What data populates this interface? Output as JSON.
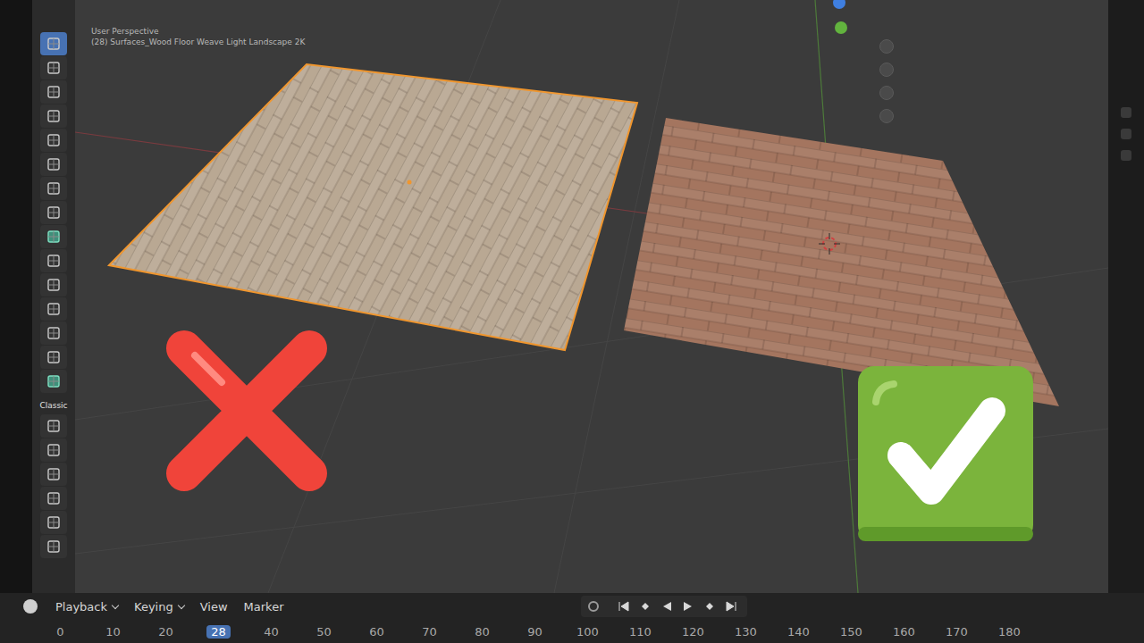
{
  "viewport": {
    "header": [
      "User Perspective",
      "(28) Surfaces_Wood Floor Weave Light Landscape 2K"
    ]
  },
  "toolbar": {
    "groups": [
      {
        "label": "",
        "tools": [
          {
            "kind": "tool",
            "selected": true
          },
          {
            "kind": "tool",
            "selected": false
          },
          {
            "kind": "tool",
            "selected": false
          },
          {
            "kind": "tool",
            "selected": false
          },
          {
            "kind": "tool",
            "selected": false
          },
          {
            "kind": "tool",
            "selected": false
          },
          {
            "kind": "tool",
            "selected": false
          },
          {
            "kind": "tool",
            "selected": false
          },
          {
            "kind": "add",
            "selected": false
          },
          {
            "kind": "tool",
            "selected": false
          },
          {
            "kind": "tool",
            "selected": false
          },
          {
            "kind": "tool",
            "selected": false
          },
          {
            "kind": "tool",
            "selected": false
          },
          {
            "kind": "tool",
            "selected": false
          },
          {
            "kind": "add",
            "selected": false
          }
        ]
      },
      {
        "label": "Classic",
        "tools": [
          {
            "kind": "tool",
            "selected": false
          },
          {
            "kind": "tool",
            "selected": false
          },
          {
            "kind": "tool",
            "selected": false
          },
          {
            "kind": "tool",
            "selected": false
          },
          {
            "kind": "tool",
            "selected": false
          },
          {
            "kind": "tool",
            "selected": false
          }
        ]
      }
    ]
  },
  "objects": [
    {
      "selected": true,
      "approved": false,
      "color": "#b9a893"
    },
    {
      "selected": false,
      "approved": true,
      "color": "#a4755f"
    }
  ],
  "timeline": {
    "menus": [
      {
        "label": "Playback",
        "kind": "dropdown"
      },
      {
        "label": "Keying",
        "kind": "dropdown"
      },
      {
        "label": "View",
        "kind": "menu"
      },
      {
        "label": "Marker",
        "kind": "menu"
      }
    ],
    "auto_key": false,
    "ticks": [
      {
        "label": "0",
        "current": false
      },
      {
        "label": "10",
        "current": false
      },
      {
        "label": "20",
        "current": false
      },
      {
        "label": "28",
        "current": true
      },
      {
        "label": "40",
        "current": false
      },
      {
        "label": "50",
        "current": false
      },
      {
        "label": "60",
        "current": false
      },
      {
        "label": "70",
        "current": false
      },
      {
        "label": "80",
        "current": false
      },
      {
        "label": "90",
        "current": false
      },
      {
        "label": "100",
        "current": false
      },
      {
        "label": "110",
        "current": false
      },
      {
        "label": "120",
        "current": false
      },
      {
        "label": "130",
        "current": false
      },
      {
        "label": "140",
        "current": false
      },
      {
        "label": "150",
        "current": false
      },
      {
        "label": "160",
        "current": false
      },
      {
        "label": "170",
        "current": false
      },
      {
        "label": "180",
        "current": false
      }
    ]
  }
}
